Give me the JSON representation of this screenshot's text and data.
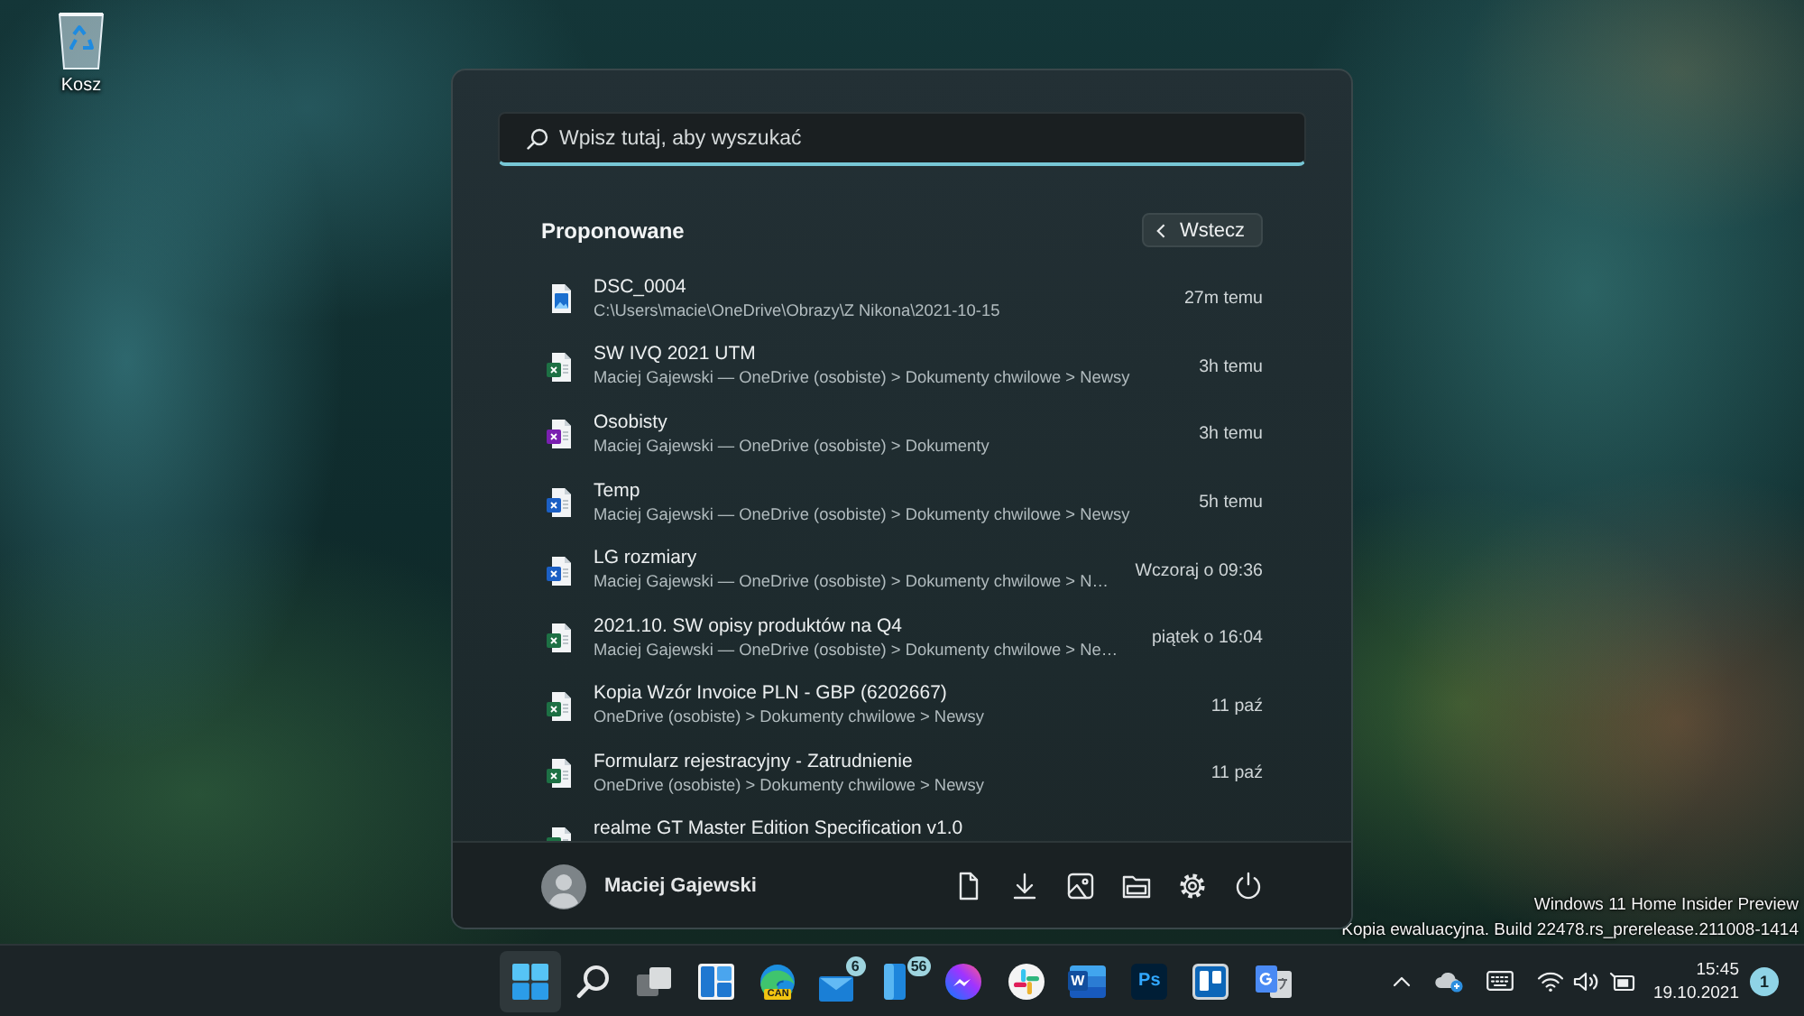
{
  "desktop": {
    "icons": [
      {
        "kind": "recycle_bin",
        "label": "Kosz"
      }
    ],
    "watermark": [
      "Windows 11 Home Insider Preview",
      "Kopia ewaluacyjna. Build 22478.rs_prerelease.211008-1414"
    ]
  },
  "start_menu": {
    "search": {
      "placeholder": "Wpisz tutaj, aby wyszukać"
    },
    "section_title": "Proponowane",
    "back_button": "Wstecz",
    "items": [
      {
        "kind": "image",
        "title": "DSC_0004",
        "subtitle": "C:\\Users\\macie\\OneDrive\\Obrazy\\Z Nikona\\2021-10-15",
        "time": "27m temu"
      },
      {
        "kind": "excel",
        "title": "SW IVQ 2021 UTM",
        "subtitle": "Maciej Gajewski — OneDrive (osobiste) > Dokumenty chwilowe > Newsy",
        "time": "3h temu"
      },
      {
        "kind": "onenote",
        "title": "Osobisty",
        "subtitle": "Maciej Gajewski — OneDrive (osobiste) > Dokumenty",
        "time": "3h temu"
      },
      {
        "kind": "word",
        "title": "Temp",
        "subtitle": "Maciej Gajewski — OneDrive (osobiste) > Dokumenty chwilowe > Newsy",
        "time": "5h temu"
      },
      {
        "kind": "word",
        "title": "LG rozmiary",
        "subtitle": "Maciej Gajewski — OneDrive (osobiste) > Dokumenty chwilowe > N…",
        "time": "Wczoraj o 09:36"
      },
      {
        "kind": "excel",
        "title": "2021.10. SW opisy produktów na Q4",
        "subtitle": "Maciej Gajewski — OneDrive (osobiste) > Dokumenty chwilowe > Ne…",
        "time": "piątek o 16:04"
      },
      {
        "kind": "excel",
        "title": "Kopia Wzór Invoice PLN - GBP (6202667)",
        "subtitle": "OneDrive (osobiste) > Dokumenty chwilowe > Newsy",
        "time": "11 paź"
      },
      {
        "kind": "excel",
        "title": "Formularz rejestracyjny - Zatrudnienie",
        "subtitle": "OneDrive (osobiste) > Dokumenty chwilowe > Newsy",
        "time": "11 paź"
      },
      {
        "kind": "excel",
        "title": "realme GT Master Edition Specification v1.0"
      }
    ],
    "user": {
      "name": "Maciej Gajewski"
    }
  },
  "taskbar": {
    "apps": [
      {
        "kind": "start",
        "selected": true
      },
      {
        "kind": "search",
        "selected": false
      },
      {
        "kind": "task_view",
        "selected": false
      },
      {
        "kind": "widgets",
        "selected": false
      },
      {
        "kind": "edge",
        "selected": false,
        "tag": "CAN"
      },
      {
        "kind": "mail",
        "selected": false,
        "badge": "6"
      },
      {
        "kind": "phone",
        "selected": false,
        "badge": "56"
      },
      {
        "kind": "messenger",
        "selected": false
      },
      {
        "kind": "slack",
        "selected": false
      },
      {
        "kind": "word",
        "selected": false,
        "glyph": "W"
      },
      {
        "kind": "photoshop",
        "selected": false,
        "glyph": "Ps"
      },
      {
        "kind": "trello",
        "selected": false
      },
      {
        "kind": "translate",
        "selected": false
      }
    ],
    "clock": {
      "time": "15:45",
      "date": "19.10.2021"
    },
    "notification_count": "1"
  }
}
